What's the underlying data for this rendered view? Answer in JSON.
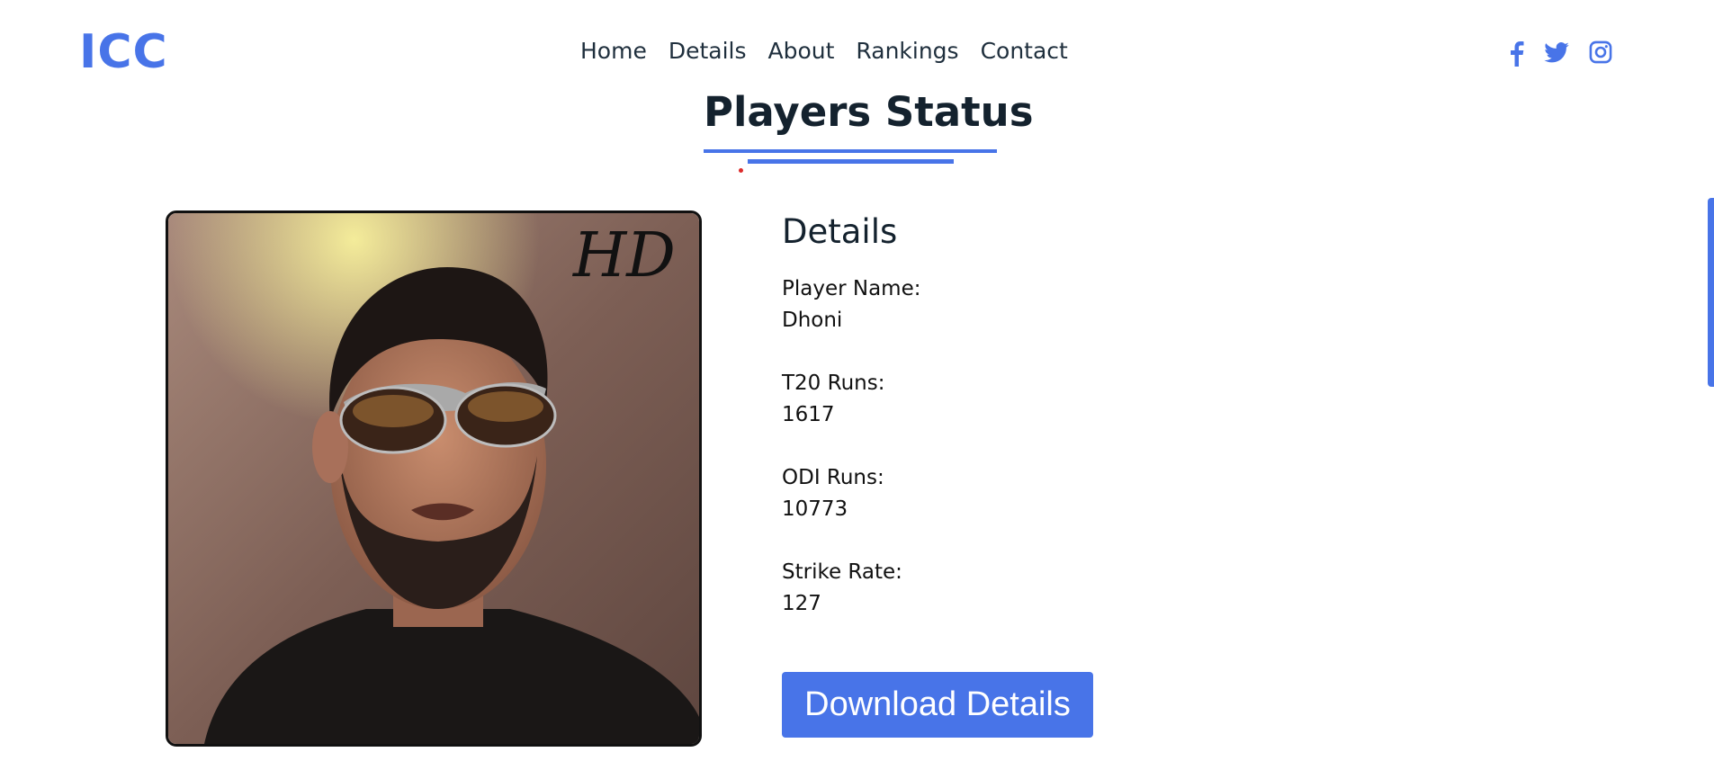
{
  "header": {
    "logo": "ICC",
    "nav": [
      "Home",
      "Details",
      "About",
      "Rankings",
      "Contact"
    ],
    "social_icons": [
      "facebook-icon",
      "twitter-icon",
      "instagram-icon"
    ]
  },
  "page_title": "Players Status",
  "details": {
    "heading": "Details",
    "fields": [
      {
        "label": "Player Name:",
        "value": "Dhoni"
      },
      {
        "label": "T20 Runs:",
        "value": "1617"
      },
      {
        "label": "ODI Runs:",
        "value": "10773"
      },
      {
        "label": "Strike Rate:",
        "value": "127"
      }
    ],
    "download_label": "Download Details"
  },
  "photo_watermark": "HD",
  "colors": {
    "accent": "#4874e8",
    "heading": "#14222e"
  }
}
